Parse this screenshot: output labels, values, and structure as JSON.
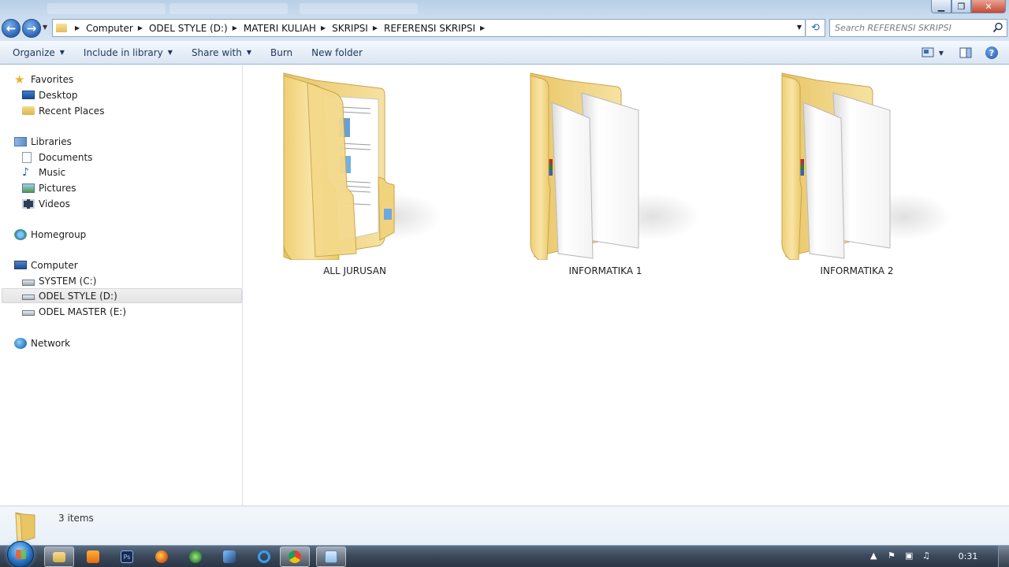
{
  "window": {
    "minimize_glyph": "▁",
    "maximize_glyph": "❐",
    "close_glyph": "✕"
  },
  "address": {
    "crumbs": [
      "Computer",
      "ODEL STYLE (D:)",
      "MATERI KULIAH",
      "SKRIPSI",
      "REFERENSI SKRIPSI"
    ]
  },
  "search": {
    "placeholder": "Search REFERENSI SKRIPSI"
  },
  "toolbar": {
    "organize": "Organize",
    "include_in_library": "Include in library",
    "share_with": "Share with",
    "burn": "Burn",
    "new_folder": "New folder",
    "help_glyph": "?"
  },
  "navpane": {
    "favorites": "Favorites",
    "desktop": "Desktop",
    "recent_places": "Recent Places",
    "libraries": "Libraries",
    "documents": "Documents",
    "music": "Music",
    "pictures": "Pictures",
    "videos": "Videos",
    "homegroup": "Homegroup",
    "computer": "Computer",
    "drive_c": "SYSTEM (C:)",
    "drive_d": "ODEL STYLE (D:)",
    "drive_e": "ODEL MASTER (E:)",
    "network": "Network"
  },
  "content": {
    "folders": [
      {
        "name": "ALL JURUSAN",
        "kind": "documents-folder-icon"
      },
      {
        "name": "INFORMATIKA 1",
        "kind": "archives-folder-icon"
      },
      {
        "name": "INFORMATIKA 2",
        "kind": "archives-folder-icon"
      }
    ]
  },
  "details": {
    "count": "3 items"
  },
  "taskbar": {
    "clock": "0:31"
  },
  "colors": {
    "accent": "#2a64b8",
    "folder_yellow": "#f3d27a",
    "taskbar": "#3c4a5c"
  }
}
